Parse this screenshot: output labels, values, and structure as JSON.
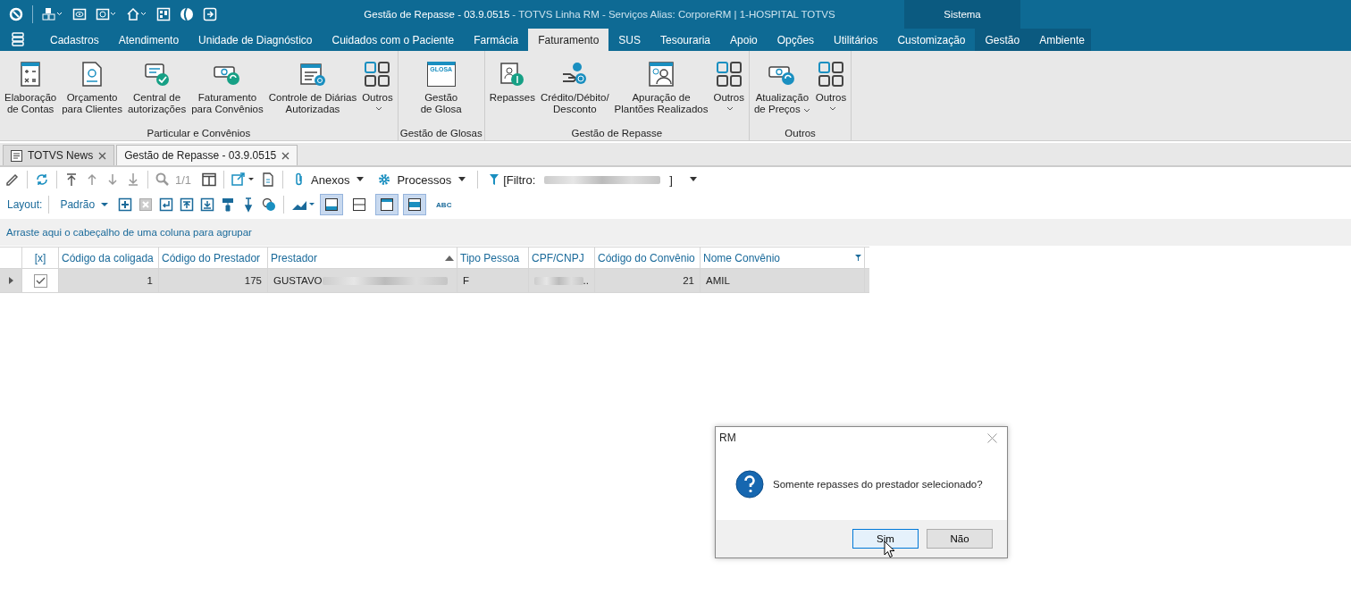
{
  "title_bar": {
    "title": "Gestão de Repasse - 03.9.0515",
    "subtitle": "- TOTVS Linha RM - Serviços  Alias: CorporeRM | 1-HOSPITAL TOTVS",
    "system_label": "Sistema"
  },
  "menu": {
    "tabs": [
      {
        "label": "Cadastros",
        "selected": false
      },
      {
        "label": "Atendimento",
        "selected": false
      },
      {
        "label": "Unidade de Diagnóstico",
        "selected": false
      },
      {
        "label": "Cuidados com o Paciente",
        "selected": false
      },
      {
        "label": "Farmácia",
        "selected": false
      },
      {
        "label": "Faturamento",
        "selected": true
      },
      {
        "label": "SUS",
        "selected": false
      },
      {
        "label": "Tesouraria",
        "selected": false
      },
      {
        "label": "Apoio",
        "selected": false
      },
      {
        "label": "Opções",
        "selected": false
      },
      {
        "label": "Utilitários",
        "selected": false
      },
      {
        "label": "Customização",
        "selected": false
      }
    ],
    "system_tabs": [
      {
        "label": "Gestão",
        "selected": false
      },
      {
        "label": "Ambiente",
        "selected": false
      }
    ]
  },
  "ribbon": {
    "groups": [
      {
        "label": "Particular e Convênios",
        "items": [
          {
            "kind": "calc",
            "lines": [
              "Elaboração",
              "de Contas"
            ],
            "dropdown": false
          },
          {
            "kind": "doc",
            "lines": [
              "Orçamento",
              "para Clientes"
            ],
            "dropdown": false
          },
          {
            "kind": "monitor",
            "lines": [
              "Central de",
              "autorizações"
            ],
            "dropdown": false
          },
          {
            "kind": "money",
            "lines": [
              "Faturamento",
              "para Convênios"
            ],
            "dropdown": false
          },
          {
            "kind": "calendar",
            "lines": [
              "Controle de Diárias",
              "Autorizadas"
            ],
            "dropdown": false
          },
          {
            "kind": "grid",
            "lines": [
              "Outros"
            ],
            "dropdown": true
          }
        ]
      },
      {
        "label": "Gestão de Glosas",
        "items": [
          {
            "kind": "glosa",
            "lines": [
              "Gestão",
              "de Glosa"
            ],
            "dropdown": false,
            "badge": "GLOSA"
          }
        ]
      },
      {
        "label": "Gestão de Repasse",
        "items": [
          {
            "kind": "repasse",
            "lines": [
              "Repasses"
            ],
            "dropdown": false
          },
          {
            "kind": "hand",
            "lines": [
              "Crédito/Débito/",
              "Desconto"
            ],
            "dropdown": false
          },
          {
            "kind": "person",
            "lines": [
              "Apuração de",
              "Plantões Realizados"
            ],
            "dropdown": false
          },
          {
            "kind": "grid",
            "lines": [
              "Outros"
            ],
            "dropdown": true
          }
        ]
      },
      {
        "label": "Outros",
        "items": [
          {
            "kind": "money-refresh",
            "lines": [
              "Atualização",
              "de Preços"
            ],
            "dropdown": true
          },
          {
            "kind": "grid",
            "lines": [
              "Outros"
            ],
            "dropdown": true
          }
        ]
      }
    ]
  },
  "doc_tabs": [
    {
      "label": "TOTVS News",
      "selected": false,
      "has_icon": true
    },
    {
      "label": "Gestão de Repasse - 03.9.0515",
      "selected": true,
      "has_icon": false
    }
  ],
  "toolbar": {
    "page_info": "1/1",
    "attachments": "Anexos",
    "processes": "Processos",
    "filter_prefix": "[Filtro:",
    "filter_suffix": "]"
  },
  "layout_bar": {
    "label": "Layout:",
    "layout": "Padrão",
    "toggles": [
      {
        "selected": true
      },
      {
        "selected": false
      },
      {
        "selected": true
      },
      {
        "selected": true
      }
    ],
    "format_label": "ABC"
  },
  "group_panel": {
    "hint": "Arraste aqui o cabeçalho de uma coluna para agrupar"
  },
  "table": {
    "check_header": "[x]",
    "columns": [
      {
        "label": "Código da coligada",
        "sorted": false,
        "filtered": false
      },
      {
        "label": "Código do Prestador",
        "sorted": false,
        "filtered": false
      },
      {
        "label": "Prestador",
        "sorted": true,
        "filtered": false
      },
      {
        "label": "Tipo Pessoa",
        "sorted": false,
        "filtered": false
      },
      {
        "label": "CPF/CNPJ",
        "sorted": false,
        "filtered": false
      },
      {
        "label": "Código do Convênio",
        "sorted": false,
        "filtered": false
      },
      {
        "label": "Nome Convênio",
        "sorted": false,
        "filtered": true
      }
    ],
    "rows": [
      {
        "selected": true,
        "checked": true,
        "cells": [
          {
            "text": "1",
            "redacted": false
          },
          {
            "text": "175",
            "redacted": false
          },
          {
            "text": "GUSTAVO",
            "redacted": true
          },
          {
            "text": "F",
            "redacted": false
          },
          {
            "text": "..",
            "redacted": true
          },
          {
            "text": "21",
            "redacted": false
          },
          {
            "text": "AMIL",
            "redacted": false
          }
        ]
      }
    ]
  },
  "dialog": {
    "title": "RM",
    "message": "Somente repasses do prestador selecionado?",
    "buttons": [
      {
        "label": "Sim",
        "default": true
      },
      {
        "label": "Não",
        "default": false
      }
    ]
  }
}
